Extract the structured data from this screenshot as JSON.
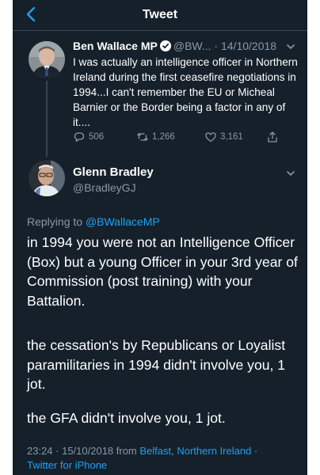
{
  "nav": {
    "title": "Tweet"
  },
  "parent_tweet": {
    "name": "Ben Wallace MP",
    "handle": "@BW...",
    "separator": "·",
    "date": "14/10/2018",
    "text": "I was actually an intelligence officer in Northern Ireland during the first ceasefire negotiations in 1994...I can't remember the EU or Micheal Barnier or the Border being a factor in any of it....",
    "replies": "506",
    "retweets": "1,266",
    "likes": "3,161"
  },
  "main_tweet": {
    "name": "Glenn Bradley",
    "handle": "@BradleyGJ",
    "replying_prefix": "Replying to",
    "replying_to": "@BWallaceMP",
    "paragraphs": [
      "in 1994 you were not an Intelligence Officer (Box) but a young Officer in your 3rd year of Commission (post training) with your Battalion.",
      "the cessation's by Republicans or Loyalist paramilitaries in 1994 didn't involve you, 1 jot.",
      "the GFA didn't involve you, 1 jot."
    ],
    "timestamp": "23:24 · 15/10/2018 from",
    "location": "Belfast, Northern Ireland",
    "dot": "·",
    "client": "Twitter for iPhone"
  },
  "colors": {
    "background": "#15202b",
    "accent": "#1da1f2",
    "muted": "#8899a6",
    "divider": "#38444d"
  }
}
